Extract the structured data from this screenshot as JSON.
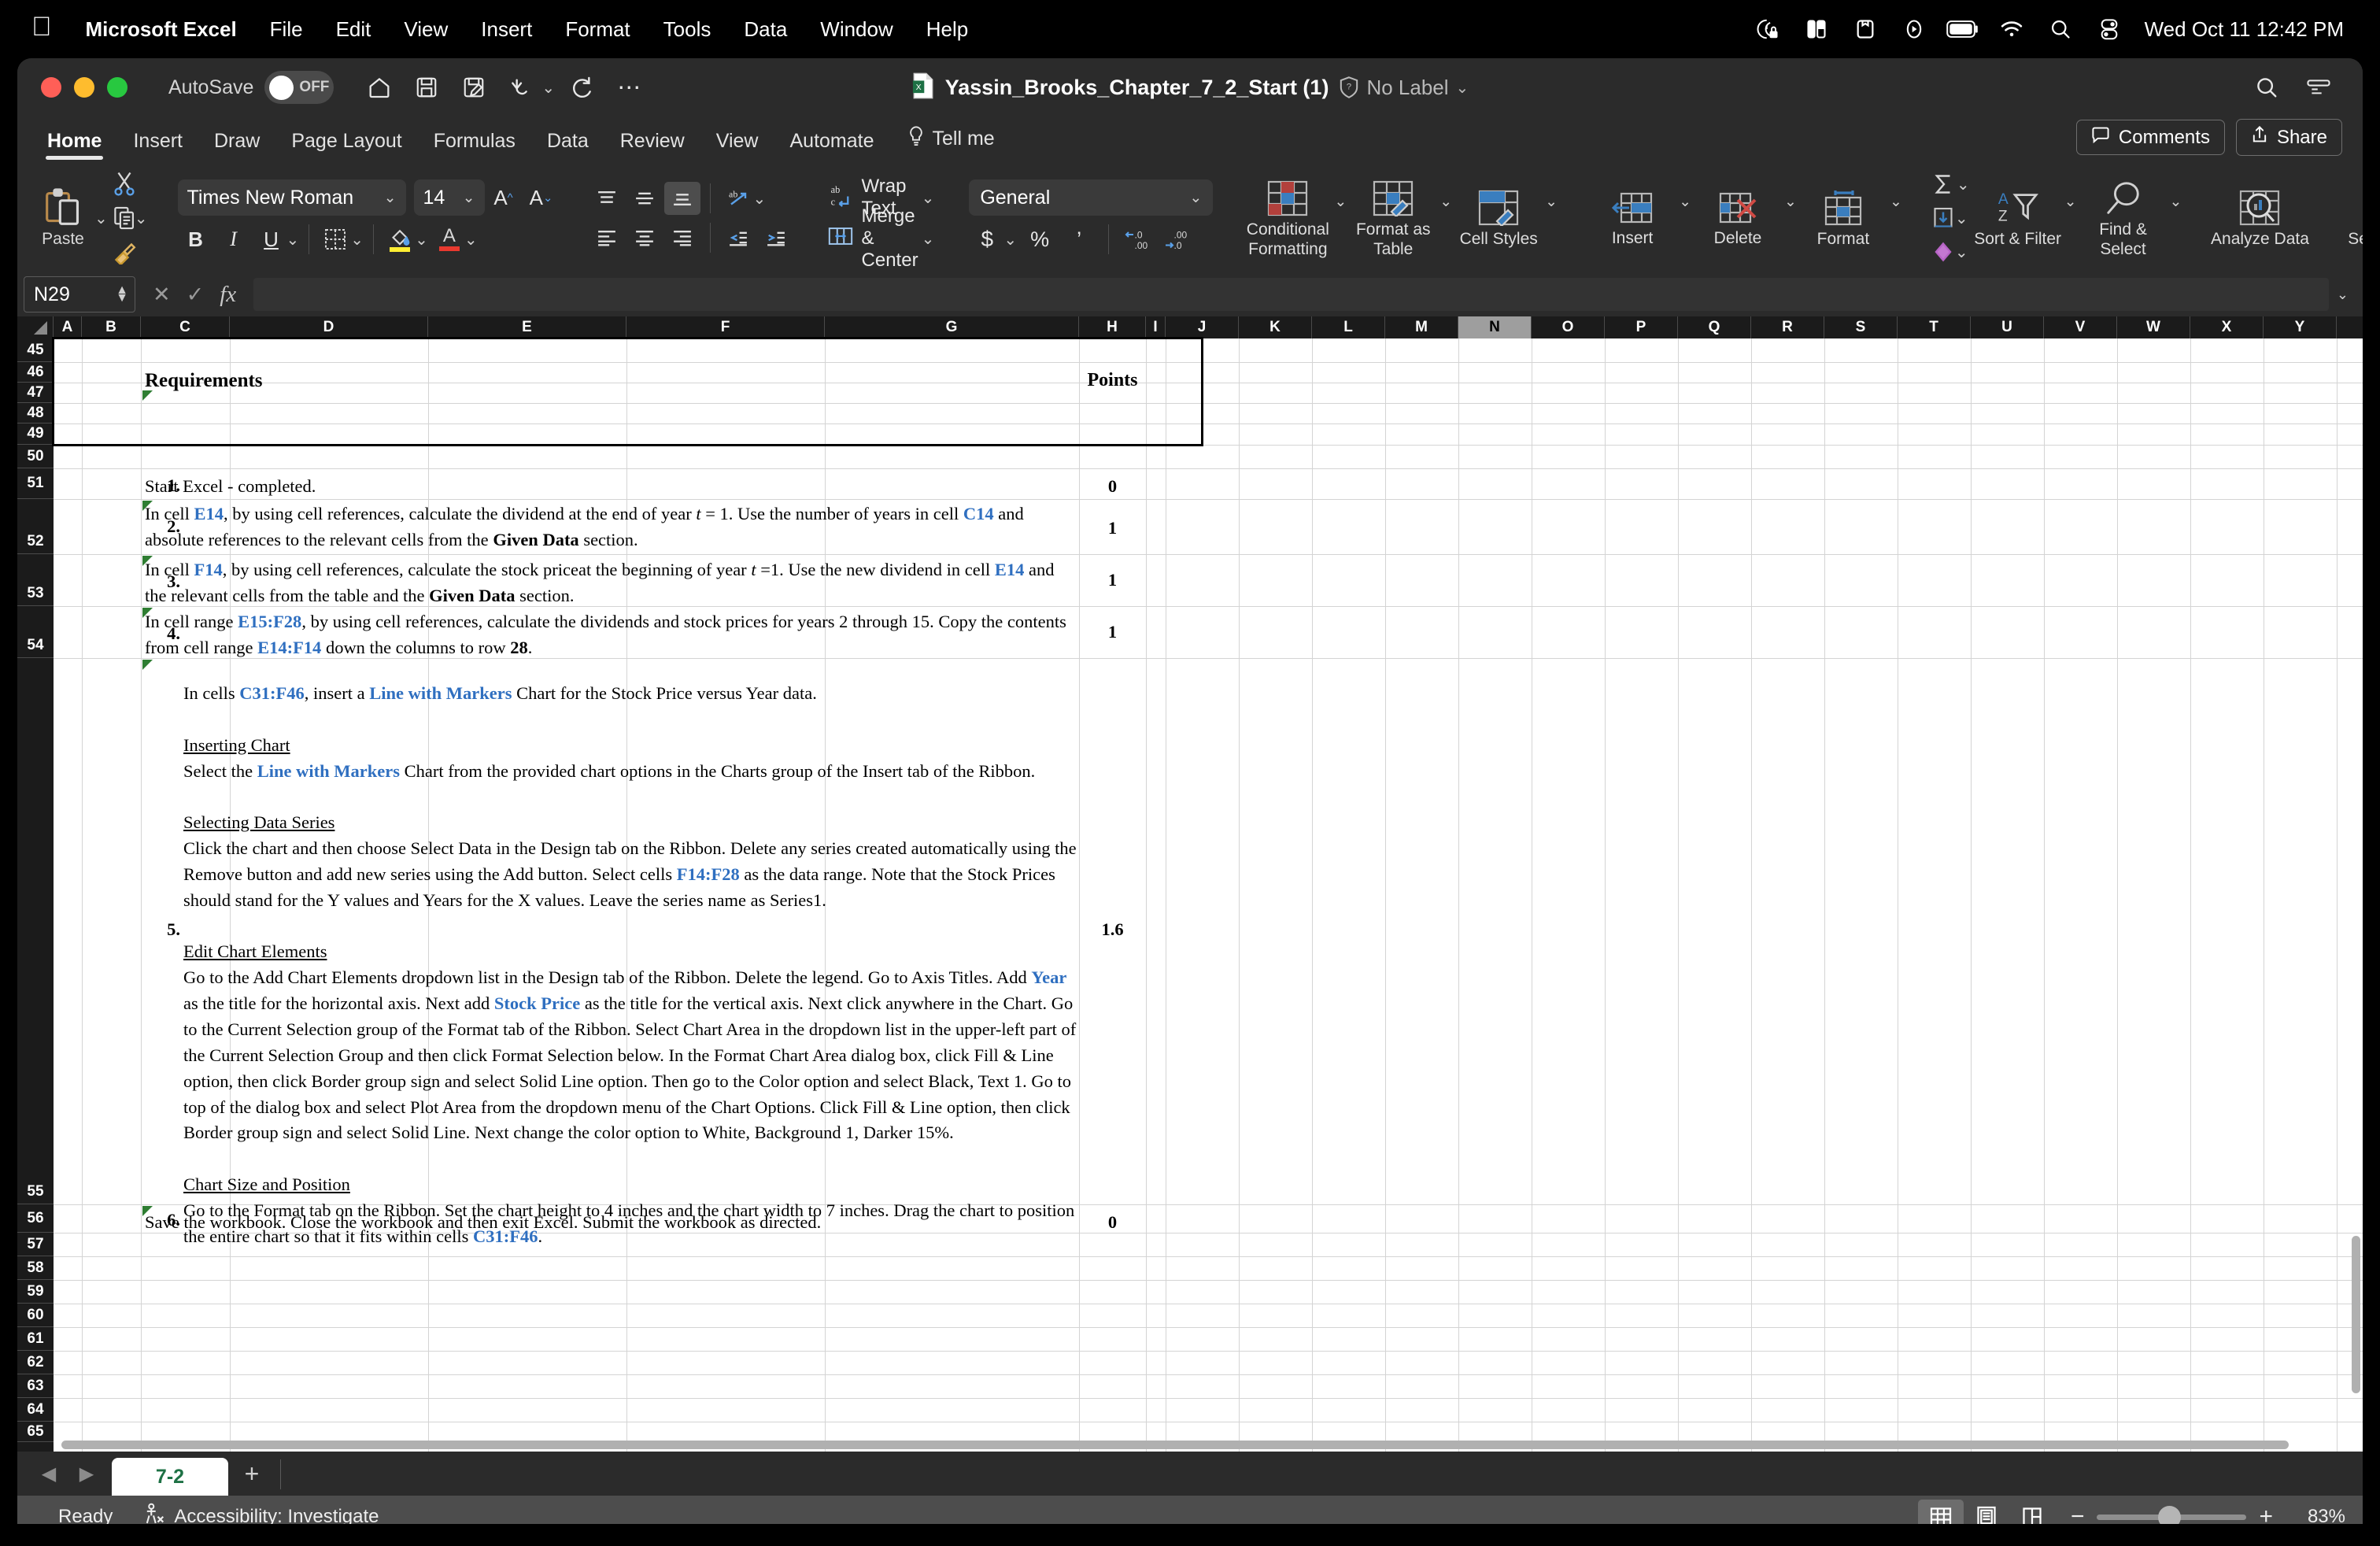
{
  "menubar": {
    "apple": "apple-logo",
    "app": "Microsoft Excel",
    "items": [
      "File",
      "Edit",
      "View",
      "Insert",
      "Format",
      "Tools",
      "Data",
      "Window",
      "Help"
    ],
    "status_icons": [
      "screen-time-lock-icon",
      "split-view-icon",
      "archive-icon",
      "play-circle-icon",
      "battery-icon",
      "wifi-icon",
      "search-icon",
      "control-center-icon"
    ],
    "clock": "Wed Oct 11  12:42 PM"
  },
  "titlebar": {
    "autosave_label": "AutoSave",
    "autosave_state": "OFF",
    "quick_access": [
      "home-icon",
      "save-icon",
      "save-as-icon",
      "undo-icon",
      "redo-icon",
      "more-icon"
    ],
    "filename": "Yassin_Brooks_Chapter_7_2_Start (1)",
    "label": "No Label",
    "right_icons": [
      "search-icon",
      "ribbon-display-icon"
    ]
  },
  "ribbon": {
    "tabs": [
      "Home",
      "Insert",
      "Draw",
      "Page Layout",
      "Formulas",
      "Data",
      "Review",
      "View",
      "Automate"
    ],
    "active_tab": "Home",
    "tell_me": "Tell me",
    "comments": "Comments",
    "share": "Share",
    "clipboard": {
      "paste_label": "Paste"
    },
    "font": {
      "name": "Times New Roman",
      "size": "14"
    },
    "alignment": {
      "wrap_text": "Wrap Text",
      "merge_center": "Merge & Center"
    },
    "number": {
      "format": "General"
    },
    "styles": {
      "conditional_formatting": "Conditional Formatting",
      "format_as_table": "Format as Table",
      "cell_styles": "Cell Styles"
    },
    "cells": {
      "insert": "Insert",
      "delete": "Delete",
      "format": "Format"
    },
    "editing": {
      "sort_filter": "Sort & Filter",
      "find_select": "Find & Select"
    },
    "analysis": {
      "analyze_data": "Analyze Data"
    },
    "sensitivity": {
      "label": "Sensitivity"
    }
  },
  "formula_bar": {
    "name_box": "N29",
    "formula": ""
  },
  "grid": {
    "columns": [
      "A",
      "B",
      "C",
      "D",
      "E",
      "F",
      "G",
      "H",
      "I",
      "J",
      "K",
      "L",
      "M",
      "N",
      "O",
      "P",
      "Q",
      "R",
      "S",
      "T",
      "U",
      "V",
      "W",
      "X",
      "Y"
    ],
    "selected_column": "N",
    "rows": [
      "45",
      "46",
      "47",
      "48",
      "49",
      "50",
      "51",
      "52",
      "53",
      "54",
      "55",
      "56",
      "57",
      "58",
      "59",
      "60",
      "61",
      "62",
      "63",
      "64",
      "65"
    ],
    "header_row": {
      "requirements": "Requirements",
      "points": "Points"
    },
    "requirements": [
      {
        "num": "1.",
        "points": "0",
        "text_html": "Start Excel - completed."
      },
      {
        "num": "2.",
        "points": "1",
        "text_html": "In cell <b class='blue'>E14</b>, by using cell references, calculate the dividend at the end of year <i>t</i> = 1. Use the number of years in cell <b class='blue'>C14</b> and absolute references to the relevant cells from the <b>Given Data</b> section."
      },
      {
        "num": "3.",
        "points": "1",
        "text_html": "In cell <b class='blue'>F14</b>, by using cell references, calculate the stock priceat the beginning of year <i>t</i> =1. Use the new dividend in cell <b class='blue'>E14</b> and the relevant cells from the table and the <b>Given Data</b> section."
      },
      {
        "num": "4.",
        "points": "1",
        "text_html": "In cell range <b class='blue'>E15:F28</b>, by using cell references, calculate the dividends and stock prices for years 2 through 15. Copy the contents from cell range <b class='blue'>E14:F14</b> down the columns to row <b>28</b>."
      },
      {
        "num": "5.",
        "points": "1.6",
        "text_html": "In cells <b class='blue'>C31:F46</b>, insert a <b class='blue'>Line with Markers</b> Chart for the Stock Price versus Year data.<br><br><span class='ul'>Inserting Chart</span><br>Select the <b class='blue'>Line with Markers</b> Chart from the provided chart options in the Charts group of the Insert tab of the Ribbon.<br><br><span class='ul'>Selecting Data Series</span><br>Click the chart and then choose Select Data in the Design tab on the Ribbon. Delete any series created automatically using the Remove button and add new series using the Add button. Select cells <b class='blue'>F14:F28</b> as the data range. Note that the Stock Prices should stand for the Y values and Years for the X values. Leave the series name as Series1.<br><br><span class='ul'>Edit Chart Elements</span><br>Go to the Add Chart Elements dropdown list in the Design tab of the Ribbon. Delete the legend. Go to Axis Titles. Add <b class='blue'>Year</b> as the title for the horizontal axis. Next add <b class='blue'>Stock Price</b> as the title for the vertical axis. Next click anywhere in the Chart. Go to the Current Selection group of the Format tab of the Ribbon. Select Chart Area in the dropdown list in the upper-left part of the Current Selection Group and then click Format Selection below. In the Format Chart Area dialog box, click Fill &amp; Line option, then click Border group sign and select Solid Line option. Then go to the Color option and select Black, Text 1. Go to top of the dialog box and select Plot Area from the dropdown menu of the Chart Options. Click Fill &amp; Line option, then click Border group sign and select Solid Line. Next change the color option to White, Background 1, Darker 15%.<br><br><span class='ul'>Chart Size and Position</span><br>Go to the Format tab on the Ribbon. Set the chart height to 4 inches and the chart width to 7 inches. Drag the chart to position the entire chart so that it fits within cells <b class='blue'>C31:F46</b>."
      },
      {
        "num": "6.",
        "points": "0",
        "text_html": "Save the workbook. Close the workbook and then exit Excel. Submit the workbook as directed."
      }
    ]
  },
  "sheet_tabs": {
    "tabs": [
      "7-2"
    ],
    "active": "7-2",
    "add_label": "+"
  },
  "status_bar": {
    "state": "Ready",
    "accessibility": "Accessibility: Investigate",
    "view_buttons": [
      "normal-view-icon",
      "page-layout-icon",
      "page-break-icon"
    ],
    "zoom_out": "−",
    "zoom_in": "+",
    "zoom_level": "83%"
  },
  "colors": {
    "accent_blue": "#2f6fc0",
    "excel_green": "#1e7145",
    "comment_flag": "#2e7d32"
  }
}
